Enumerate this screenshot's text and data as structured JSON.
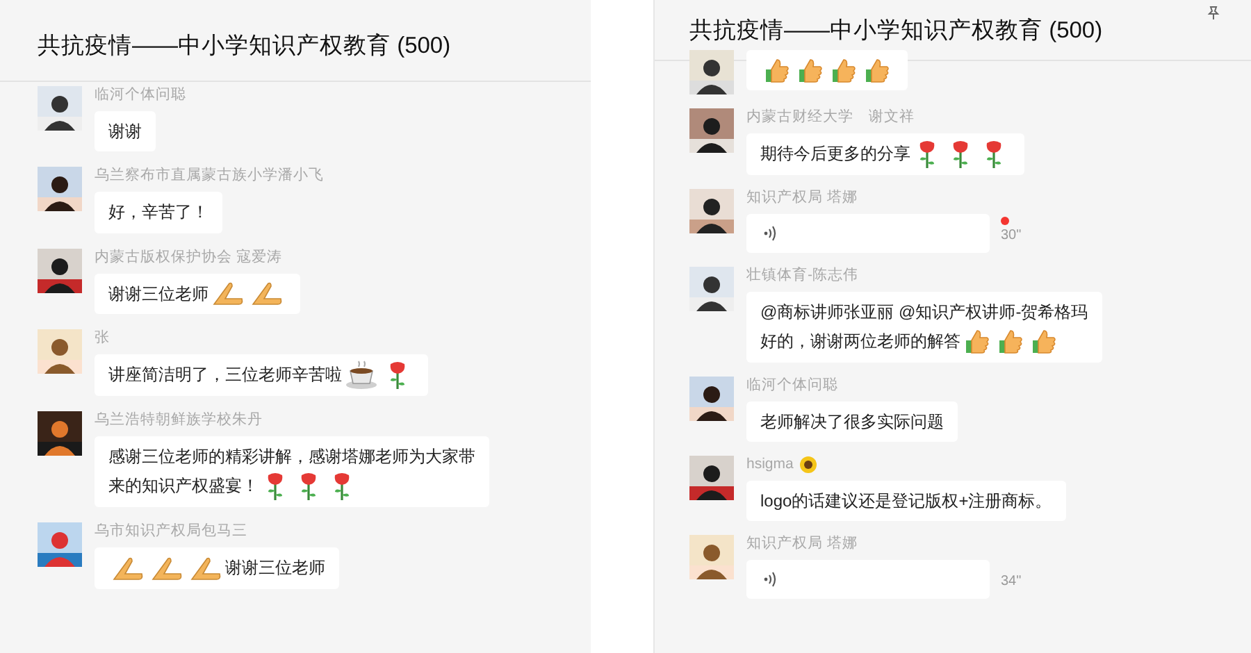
{
  "panels": [
    {
      "title": "共抗疫情——中小学知识产权教育 (500)",
      "messages": [
        {
          "sender": "临河个体问聪",
          "parts": [
            {
              "kind": "text",
              "text": "谢谢"
            }
          ]
        },
        {
          "sender": "乌兰察布市直属蒙古族小学潘小飞",
          "parts": [
            {
              "kind": "text",
              "text": "好，辛苦了！"
            }
          ]
        },
        {
          "sender": "内蒙古版权保护协会 寇爱涛",
          "parts": [
            {
              "kind": "text",
              "text": "谢谢三位老师"
            },
            {
              "kind": "pray"
            },
            {
              "kind": "pray"
            }
          ]
        },
        {
          "sender": "张",
          "parts": [
            {
              "kind": "text",
              "text": "讲座简洁明了，三位老师辛苦啦"
            },
            {
              "kind": "coffee"
            },
            {
              "kind": "rose"
            }
          ]
        },
        {
          "sender": "乌兰浩特朝鲜族学校朱丹",
          "parts": [
            {
              "kind": "text",
              "text": "感谢三位老师的精彩讲解，感谢塔娜老师为大家带"
            },
            {
              "kind": "break"
            },
            {
              "kind": "text",
              "text": "来的知识产权盛宴！"
            },
            {
              "kind": "rose"
            },
            {
              "kind": "rose"
            },
            {
              "kind": "rose"
            }
          ]
        },
        {
          "sender": "乌市知识产权局包马三",
          "parts": [
            {
              "kind": "pray"
            },
            {
              "kind": "pray"
            },
            {
              "kind": "pray"
            },
            {
              "kind": "text",
              "text": "谢谢三位老师"
            }
          ]
        }
      ]
    },
    {
      "title": "共抗疫情——中小学知识产权教育 (500)",
      "messages": [
        {
          "parts": [
            {
              "kind": "thumb"
            },
            {
              "kind": "thumb"
            },
            {
              "kind": "thumb"
            },
            {
              "kind": "thumb"
            }
          ]
        },
        {
          "sender": "内蒙古财经大学　谢文祥",
          "parts": [
            {
              "kind": "text",
              "text": "期待今后更多的分享"
            },
            {
              "kind": "rose"
            },
            {
              "kind": "rose"
            },
            {
              "kind": "rose"
            }
          ]
        },
        {
          "sender": "知识产权局 塔娜",
          "voice": {
            "duration": "30\"",
            "unread": true
          }
        },
        {
          "sender": "壮镇体育-陈志伟",
          "parts": [
            {
              "kind": "text",
              "text": "@商标讲师张亚丽 @知识产权讲师-贺希格玛"
            },
            {
              "kind": "break"
            },
            {
              "kind": "text",
              "text": "好的，谢谢两位老师的解答"
            },
            {
              "kind": "thumb"
            },
            {
              "kind": "thumb"
            },
            {
              "kind": "thumb"
            }
          ]
        },
        {
          "sender": "临河个体问聪",
          "parts": [
            {
              "kind": "text",
              "text": "老师解决了很多实际问题"
            }
          ]
        },
        {
          "sender": "hsigma",
          "sender_badge": {
            "kind": "sunflower"
          },
          "parts": [
            {
              "kind": "text",
              "text": "logo的话建议还是登记版权+注册商标。"
            }
          ]
        },
        {
          "sender": "知识产权局 塔娜",
          "voice": {
            "duration": "34\""
          }
        }
      ]
    }
  ]
}
